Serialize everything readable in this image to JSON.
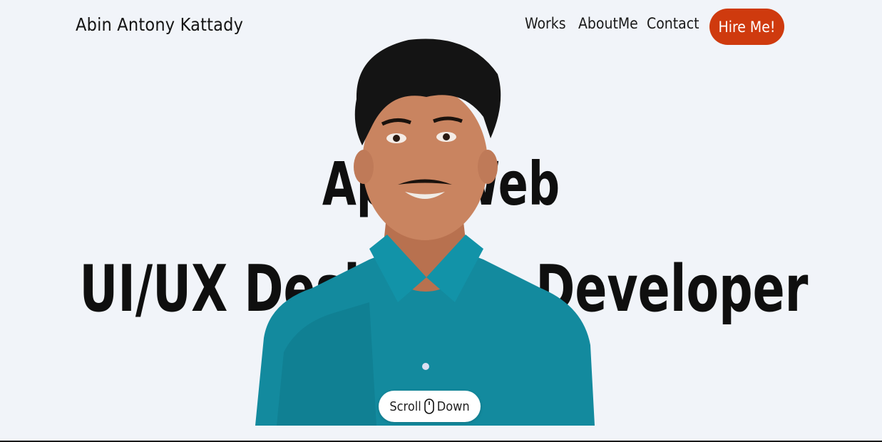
{
  "header": {
    "logo_text": "Abin Antony Kattady",
    "nav": [
      {
        "label": "Works"
      },
      {
        "label": "AboutMe"
      },
      {
        "label": "Contact"
      }
    ],
    "cta_label": "Hire Me!"
  },
  "hero": {
    "line1_left": "App",
    "line1_right": "Web",
    "line2_left": "UI/UX Designer",
    "line2_right": "Developer",
    "separator": "-",
    "photo_icon": "portrait-photo"
  },
  "scroll": {
    "label_left": "Scroll",
    "label_right": "Down",
    "icon": "mouse-icon"
  },
  "colors": {
    "background": "#f1f4f9",
    "accent": "#cf3a0e",
    "shirt": "#138a9e",
    "text": "#141414"
  }
}
